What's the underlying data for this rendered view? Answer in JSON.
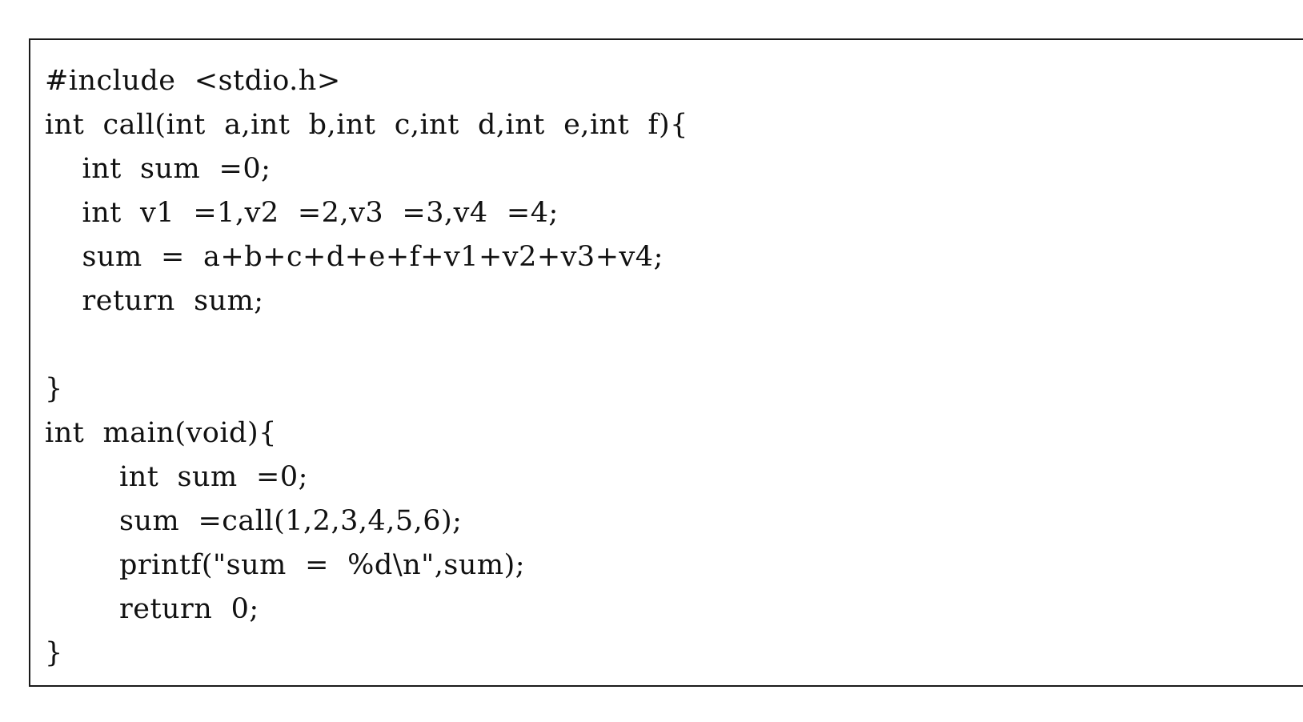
{
  "code": {
    "lines": [
      "#include  <stdio.h>",
      "int  call(int  a,int  b,int  c,int  d,int  e,int  f){",
      "    int  sum  =0;",
      "    int  v1  =1,v2  =2,v3  =3,v4  =4;",
      "    sum  =  a+b+c+d+e+f+v1+v2+v3+v4;",
      "    return  sum;",
      "",
      "}",
      "int  main(void){",
      "        int  sum  =0;",
      "        sum  =call(1,2,3,4,5,6);",
      "        printf(\"sum  =  %d\\n\",sum);",
      "        return  0;",
      "}"
    ]
  }
}
